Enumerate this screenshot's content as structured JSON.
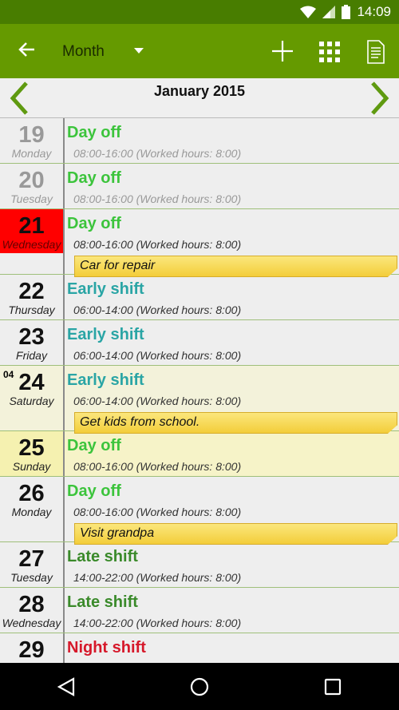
{
  "status": {
    "time": "14:09"
  },
  "toolbar": {
    "title": "Month",
    "icons": [
      "back-arrow-icon",
      "dropdown-icon",
      "add-icon",
      "grid-icon",
      "document-icon"
    ]
  },
  "month": {
    "title": "January 2015"
  },
  "colors": {
    "dayoff": "#3cc43c",
    "early": "#2aa5a5",
    "late": "#3a8a2a",
    "night": "#d6182a",
    "today": "#ff0000",
    "toolbar": "#659a00"
  },
  "days": [
    {
      "num": "19",
      "wd": "Monday",
      "shift": "Day off",
      "type": "dayoff",
      "hours": "08:00-16:00  (Worked hours: 8:00)",
      "state": "past"
    },
    {
      "num": "20",
      "wd": "Tuesday",
      "shift": "Day off",
      "type": "dayoff",
      "hours": "08:00-16:00  (Worked hours: 8:00)",
      "state": "past"
    },
    {
      "num": "21",
      "wd": "Wednesday",
      "shift": "Day off",
      "type": "dayoff",
      "hours": "08:00-16:00  (Worked hours: 8:00)",
      "state": "today",
      "note": "Car for repair"
    },
    {
      "num": "22",
      "wd": "Thursday",
      "shift": "Early shift",
      "type": "early",
      "hours": "06:00-14:00  (Worked hours: 8:00)"
    },
    {
      "num": "23",
      "wd": "Friday",
      "shift": "Early shift",
      "type": "early",
      "hours": "06:00-14:00  (Worked hours: 8:00)"
    },
    {
      "num": "24",
      "wd": "Saturday",
      "week": "04",
      "shift": "Early shift",
      "type": "early",
      "hours": "06:00-14:00  (Worked hours: 8:00)",
      "state": "sat",
      "note": "Get kids from school."
    },
    {
      "num": "25",
      "wd": "Sunday",
      "shift": "Day off",
      "type": "dayoff",
      "hours": "08:00-16:00  (Worked hours: 8:00)",
      "state": "sun"
    },
    {
      "num": "26",
      "wd": "Monday",
      "shift": "Day off",
      "type": "dayoff",
      "hours": "08:00-16:00  (Worked hours: 8:00)",
      "note": "Visit grandpa"
    },
    {
      "num": "27",
      "wd": "Tuesday",
      "shift": "Late shift",
      "type": "late",
      "hours": "14:00-22:00  (Worked hours: 8:00)"
    },
    {
      "num": "28",
      "wd": "Wednesday",
      "shift": "Late shift",
      "type": "late",
      "hours": "14:00-22:00  (Worked hours: 8:00)"
    },
    {
      "num": "29",
      "wd": "",
      "shift": "Night shift",
      "type": "night",
      "hours": ""
    }
  ]
}
